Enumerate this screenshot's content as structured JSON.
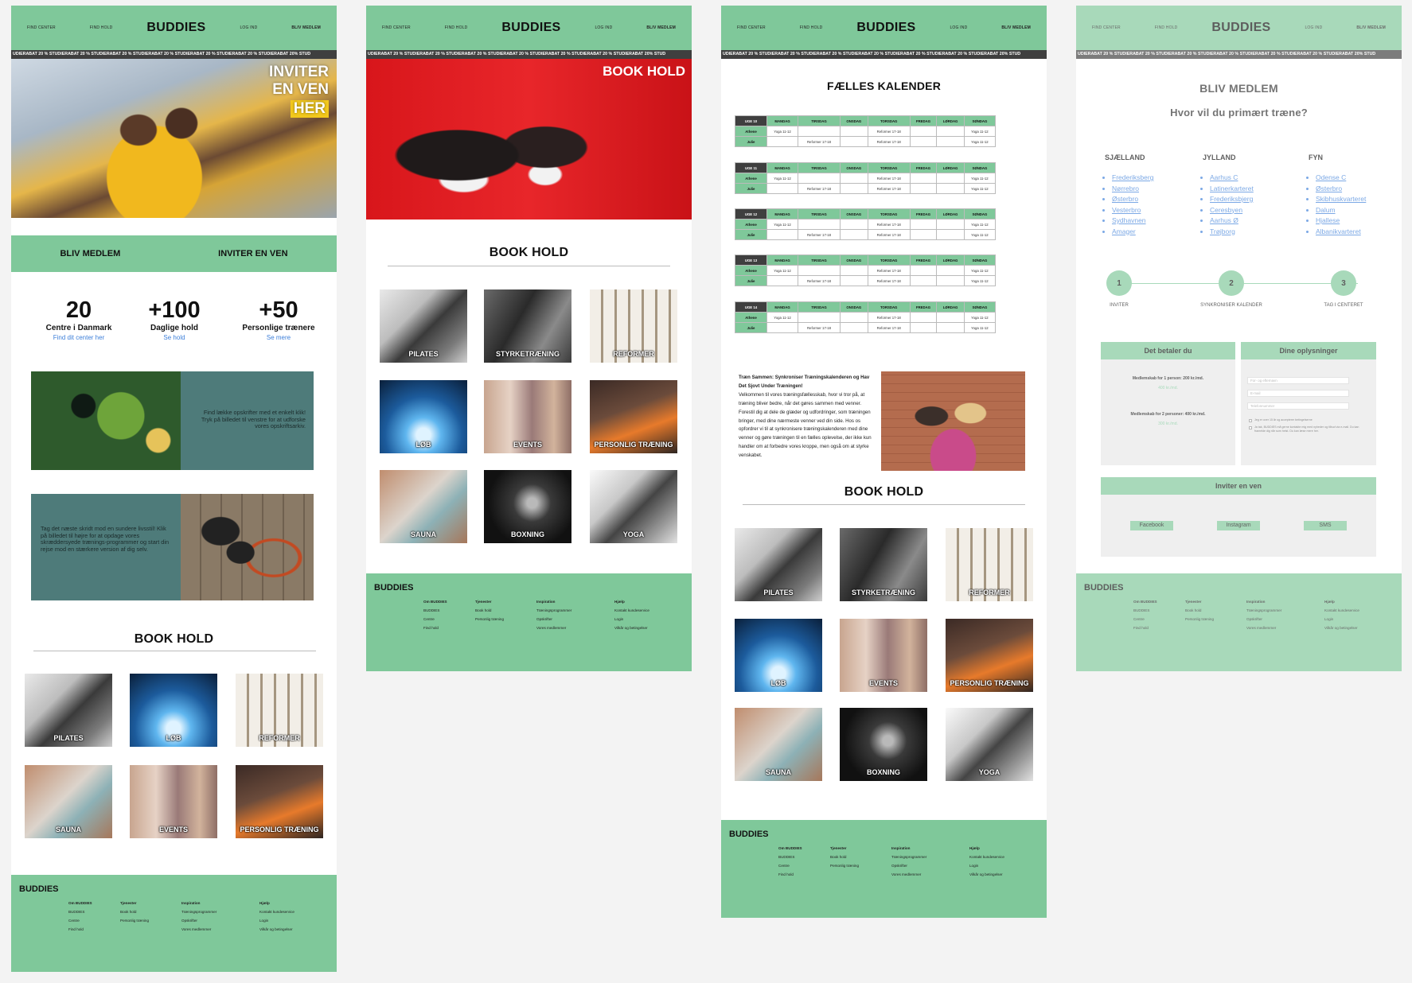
{
  "header": {
    "nav_find_center": "FIND CENTER",
    "nav_find_hold": "FIND HOLD",
    "logo": "BUDDIES",
    "nav_login": "LOG IND",
    "nav_member": "BLIV MEDLEM"
  },
  "ticker": "UDIERABAT 20 % STUDIERABAT 20 % STUDIERABAT 20 % STUDIERABAT 20 % STUDIERABAT 20 % STUDIERABAT 20 % STUDIERABAT 20% STUD",
  "home": {
    "hero_line1": "INVITER",
    "hero_line2": "EN VEN",
    "hero_line3": "HER",
    "cta_member": "BLIV MEDLEM",
    "cta_invite": "INVITER EN VEN",
    "stats": [
      {
        "number": "20",
        "title": "Centre i Danmark",
        "link": "Find dit center her"
      },
      {
        "number": "+100",
        "title": "Daglige hold",
        "link": "Se hold"
      },
      {
        "number": "+50",
        "title": "Personlige trænere",
        "link": "Se mere"
      }
    ],
    "recipes_text": "Find lække opskrifter med et enkelt klik! Tryk på billedet til venstre for at udforske vores opskriftsarkiv.",
    "programs_text": "Tag det næste skridt mod en sundere livsstil! Klik på billedet til højre for at opdage vores skræddersyede trænings-programmer og start din rejse mod en stærkere version af dig selv.",
    "book_title": "BOOK HOLD"
  },
  "book": {
    "hero_title": "BOOK HOLD",
    "section_title": "BOOK HOLD"
  },
  "classes": {
    "pilates": "PILATES",
    "styrke": "STYRKETRÆNING",
    "reformer": "REFORMER",
    "lob": "LØB",
    "events": "EVENTS",
    "personlig": "PERSONLIG TRÆNING",
    "sauna": "SAUNA",
    "boxning": "BOXNING",
    "yoga": "YOGA"
  },
  "calendar": {
    "title": "FÆLLES KALENDER",
    "days": [
      "MANDAG",
      "TIRSDAG",
      "ONSDAG",
      "TORSDAG",
      "FREDAG",
      "LØRDAG",
      "SØNDAG"
    ],
    "weeks": [
      {
        "week": "UGE 10",
        "rows": [
          {
            "name": "Athene",
            "cells": [
              "Yoga 11-12",
              "",
              "",
              "Reformer 17-18",
              "",
              "",
              "Yoga 11-12"
            ]
          },
          {
            "name": "Julie",
            "cells": [
              "",
              "Reformer 17-18",
              "",
              "Reformer 17-18",
              "",
              "",
              "Yoga 11-12"
            ]
          }
        ]
      },
      {
        "week": "UGE 11",
        "rows": [
          {
            "name": "Athene",
            "cells": [
              "Yoga 11-12",
              "",
              "",
              "Reformer 17-18",
              "",
              "",
              "Yoga 11-12"
            ]
          },
          {
            "name": "Julie",
            "cells": [
              "",
              "Reformer 17-18",
              "",
              "Reformer 17-18",
              "",
              "",
              "Yoga 11-12"
            ]
          }
        ]
      },
      {
        "week": "UGE 12",
        "rows": [
          {
            "name": "Athene",
            "cells": [
              "Yoga 11-12",
              "",
              "",
              "Reformer 17-18",
              "",
              "",
              "Yoga 11-12"
            ]
          },
          {
            "name": "Julie",
            "cells": [
              "",
              "Reformer 17-18",
              "",
              "Reformer 17-18",
              "",
              "",
              "Yoga 11-12"
            ]
          }
        ]
      },
      {
        "week": "UGE 13",
        "rows": [
          {
            "name": "Athene",
            "cells": [
              "Yoga 11-12",
              "",
              "",
              "Reformer 17-18",
              "",
              "",
              "Yoga 11-12"
            ]
          },
          {
            "name": "Julie",
            "cells": [
              "",
              "Reformer 17-18",
              "",
              "Reformer 17-18",
              "",
              "",
              "Yoga 11-12"
            ]
          }
        ]
      },
      {
        "week": "UGE 14",
        "rows": [
          {
            "name": "Athene",
            "cells": [
              "Yoga 11-12",
              "",
              "",
              "Reformer 17-18",
              "",
              "",
              "Yoga 11-12"
            ]
          },
          {
            "name": "Julie",
            "cells": [
              "",
              "Reformer 17-18",
              "",
              "Reformer 17-18",
              "",
              "",
              "Yoga 11-12"
            ]
          }
        ]
      }
    ],
    "article_title": "Træn Sammen: Synkroniser Træningskalenderen og Hav Det Sjovt Under Træningen!",
    "article_body": "Velkommen til vores træningsfællesskab, hvor vi tror på, at træning bliver bedre, når det gøres sammen med venner. Forestil dig at dele de glæder og udfordringer, som træningen bringer, med dine nærmeste venner ved din side. Hos os opfordrer vi til at synkronisere træningskalenderen med dine venner og gøre træningen til en fælles oplevelse, der ikke kun handler om at forbedre vores kroppe, men også om at styrke venskabet.",
    "book_title": "BOOK HOLD"
  },
  "member": {
    "title": "BLIV MEDLEM",
    "question": "Hvor vil du primært træne?",
    "regions": [
      {
        "name": "SJÆLLAND",
        "cities": [
          "Frederiksberg",
          "Nørrebro",
          "Østerbro",
          "Vesterbro",
          "Sydhavnen",
          "Amager"
        ]
      },
      {
        "name": "JYLLAND",
        "cities": [
          "Aarhus C",
          "Latinerkarteret",
          "Frederiksbjerg",
          "Ceresbyen",
          "Aarhus Ø",
          "Trøjborg"
        ]
      },
      {
        "name": "FYN",
        "cities": [
          "Odense C",
          "Østerbro",
          "Skibhuskvarteret",
          "Dalum",
          "Hjallese",
          "Albanikvarteret"
        ]
      }
    ],
    "steps": [
      {
        "num": "1",
        "label": "INVITER"
      },
      {
        "num": "2",
        "label": "SYNKRONISER KALENDER"
      },
      {
        "num": "3",
        "label": "TAG I CENTERET"
      }
    ],
    "pay_title": "Det betaler du",
    "pay_line1": "Medlemskab for 1 person: 200 kr./md.",
    "pay_price1": "400 kr./md.",
    "pay_line2": "Medlemskab for 2 personer: 400 kr./md.",
    "pay_price2": "300 kr./md.",
    "info_title": "Dine oplysninger",
    "ph_name": "For- og efternavn",
    "ph_email": "E-mail",
    "ph_phone": "Telefonnummer",
    "terms1": "Jeg er over 15 år og accepterer betingelserne",
    "terms2": "Ja tak, BUDDIES må gerne kontakte mig med nyheder og tilbud via e-mail. Du kan framelde dig når som helst. Du kan læse mere her.",
    "invite_title": "Inviter en ven",
    "share_facebook": "Facebook",
    "share_instagram": "Instagram",
    "share_sms": "SMS"
  },
  "footer": {
    "logo": "BUDDIES",
    "col1_head": "Om BUDDIES",
    "col1": [
      "BUDDIES",
      "Centre",
      "Find hold"
    ],
    "col2_head": "Tjenester",
    "col2": [
      "Book hold",
      "Personlig træning"
    ],
    "col3_head": "Inspiration",
    "col3": [
      "Træningsprogrammer",
      "Opskrifter",
      "Vores medlemmer"
    ],
    "col4_head": "Hjælp",
    "col4": [
      "Kontakt kundeservice",
      "Login",
      "Vilkår og betingelser"
    ]
  },
  "colors": {
    "brand_green": "#7fc89a",
    "dark": "#3f3f3f",
    "link_blue": "#3d7fd9"
  }
}
